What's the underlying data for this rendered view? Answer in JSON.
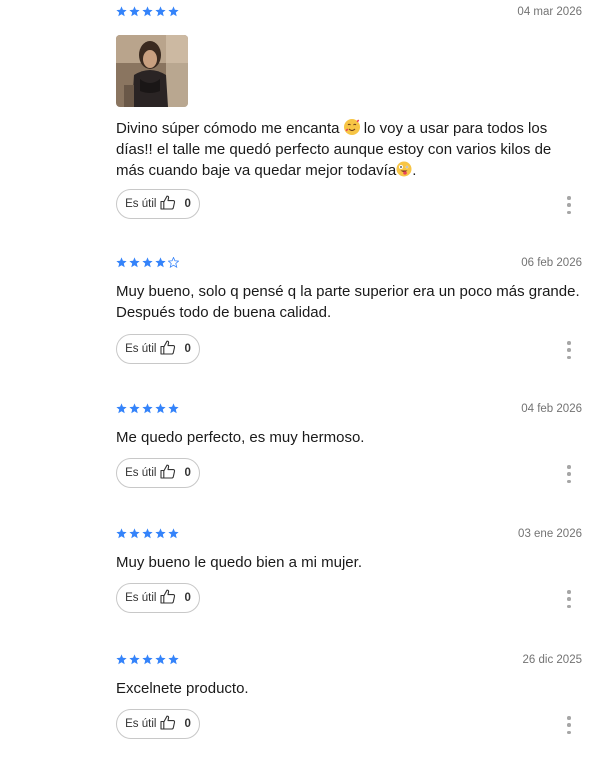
{
  "colors": {
    "star": "#3483fa",
    "star_empty": "#3483fa",
    "muted": "#737373"
  },
  "reviews": [
    {
      "rating": 5,
      "date": "04 mar 2026",
      "has_photo": true,
      "text_a": "Divino súper cómodo me encanta ",
      "emoji_a": "smiling-face-with-hearts",
      "text_b": " lo voy a usar para todos los días!! el talle me quedó perfecto aunque estoy con varios kilos de más cuando baje va quedar mejor todavía",
      "emoji_b": "zany-face",
      "text_c": ".",
      "useful_label": "Es útil",
      "useful_count": "0"
    },
    {
      "rating": 4,
      "date": "06 feb 2026",
      "text": "Muy bueno, solo q pensé q la parte superior era un poco más grande. Después todo de buena calidad.",
      "useful_label": "Es útil",
      "useful_count": "0"
    },
    {
      "rating": 5,
      "date": "04 feb 2026",
      "text": "Me quedo perfecto, es muy hermoso.",
      "useful_label": "Es útil",
      "useful_count": "0"
    },
    {
      "rating": 5,
      "date": "03 ene 2026",
      "text": "Muy bueno le quedo bien a mi mujer.",
      "useful_label": "Es útil",
      "useful_count": "0"
    },
    {
      "rating": 5,
      "date": "26 dic 2025",
      "text": "Excelnete producto.",
      "useful_label": "Es útil",
      "useful_count": "0"
    }
  ]
}
